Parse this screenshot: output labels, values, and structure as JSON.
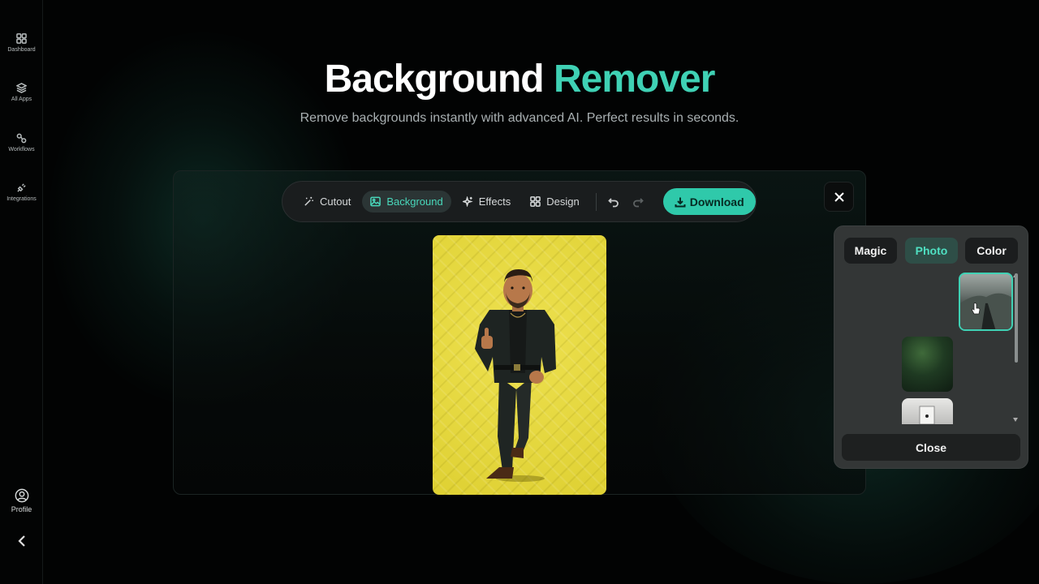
{
  "sidebar": {
    "items": [
      {
        "label": "Dashboard",
        "icon": "grid-icon"
      },
      {
        "label": "All Apps",
        "icon": "layers-icon"
      },
      {
        "label": "Workflows",
        "icon": "workflow-icon"
      },
      {
        "label": "Integrations",
        "icon": "plug-icon"
      }
    ],
    "profile_label": "Profile"
  },
  "header": {
    "title_main": "Background",
    "title_accent": "Remover",
    "subtitle": "Remove backgrounds instantly with advanced AI. Perfect results in seconds."
  },
  "toolbar": {
    "tools": [
      {
        "label": "Cutout",
        "icon": "magic-wand-icon",
        "active": false
      },
      {
        "label": "Background",
        "icon": "image-icon",
        "active": true
      },
      {
        "label": "Effects",
        "icon": "sparkles-icon",
        "active": false
      },
      {
        "label": "Design",
        "icon": "grid-icon",
        "active": false
      }
    ],
    "download_label": "Download"
  },
  "picker": {
    "tabs": [
      {
        "label": "Magic",
        "active": false
      },
      {
        "label": "Photo",
        "active": true
      },
      {
        "label": "Color",
        "active": false
      }
    ],
    "close_label": "Close"
  },
  "colors": {
    "accent": "#3fd1b4",
    "download_bg": "#2fc9aa",
    "photo_background": "#e4d63a"
  }
}
